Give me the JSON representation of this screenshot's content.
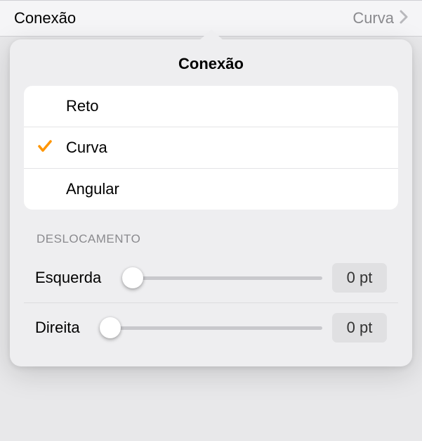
{
  "parent": {
    "label": "Conexão",
    "value": "Curva"
  },
  "popover": {
    "title": "Conexão",
    "options": [
      {
        "label": "Reto",
        "selected": false
      },
      {
        "label": "Curva",
        "selected": true
      },
      {
        "label": "Angular",
        "selected": false
      }
    ],
    "offset": {
      "header": "Deslocamento",
      "rows": [
        {
          "label": "Esquerda",
          "value": "0 pt"
        },
        {
          "label": "Direita",
          "value": "0 pt"
        }
      ]
    }
  }
}
